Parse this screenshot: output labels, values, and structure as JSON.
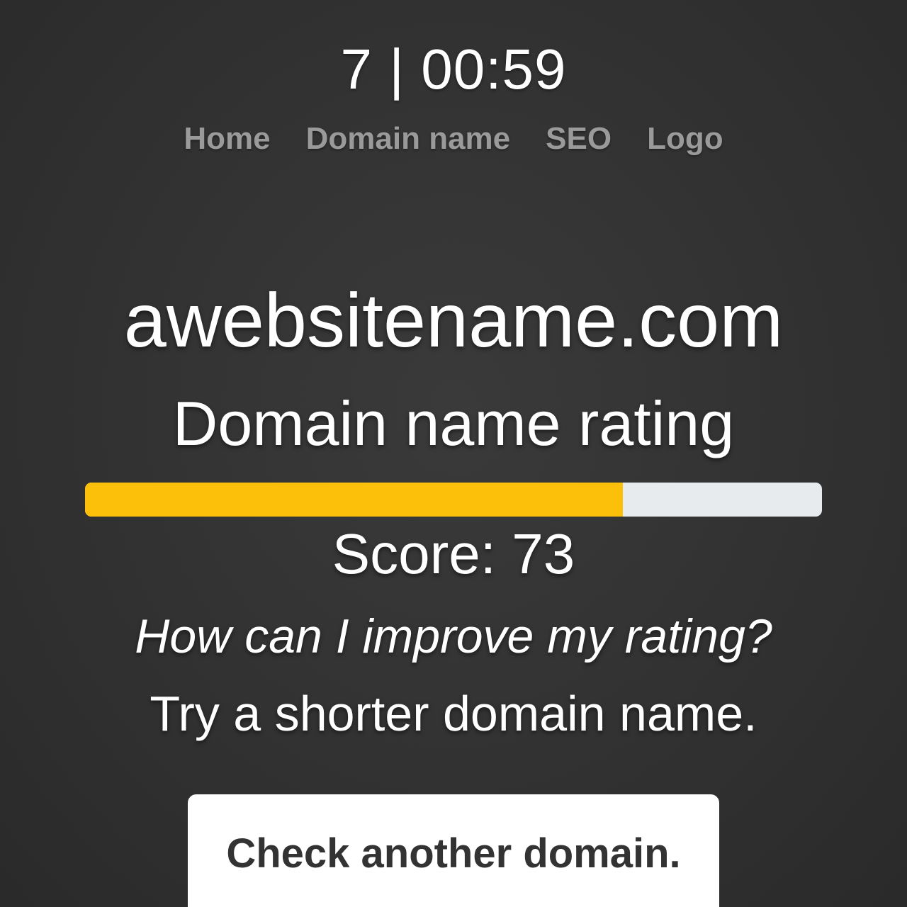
{
  "header": {
    "counter": "7 | 00:59"
  },
  "nav": {
    "items": [
      {
        "label": "Home"
      },
      {
        "label": "Domain name"
      },
      {
        "label": "SEO"
      },
      {
        "label": "Logo"
      }
    ]
  },
  "main": {
    "domain": "awebsitename.com",
    "rating_title": "Domain name rating",
    "progress": {
      "percent": 73,
      "fill_color": "#fcbf0a",
      "track_color": "#e8ebee"
    },
    "score_text": "Score: 73",
    "question": "How can I improve my rating?",
    "tip": "Try a shorter domain name.",
    "cta_label": "Check another domain."
  }
}
